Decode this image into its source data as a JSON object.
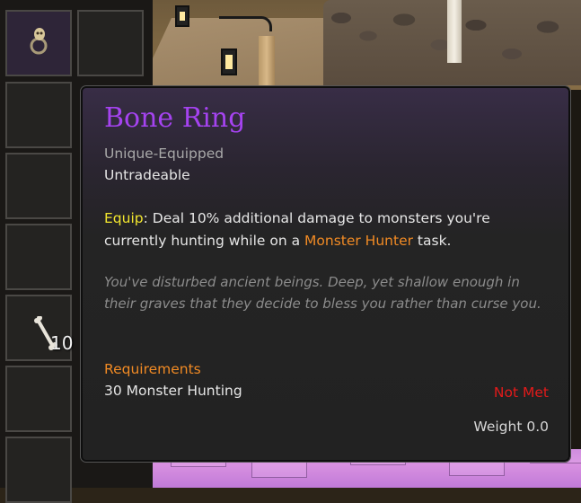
{
  "inventory": {
    "slots": [
      {
        "item": "bone-ring",
        "quantity": ""
      },
      {
        "item": "",
        "quantity": ""
      },
      {
        "item": "bone",
        "quantity": "10"
      }
    ]
  },
  "tooltip": {
    "title": "Bone Ring",
    "tags": [
      "Unique-Equipped",
      "Untradeable"
    ],
    "equip_label": "Equip",
    "equip_text_1": ": Deal 10% additional damage to monsters you're",
    "equip_text_2_pre": "currently hunting while on a ",
    "equip_highlight": "Monster Hunter",
    "equip_text_2_post": " task.",
    "flavor": "You've disturbed ancient beings. Deep, yet shallow enough in their graves that they decide to bless you rather than curse you.",
    "requirements_heading": "Requirements",
    "requirement": "30 Monster Hunting",
    "requirement_status": "Not Met",
    "weight": "Weight 0.0"
  },
  "colors": {
    "title": "#a543f0",
    "equip_label": "#f2e62e",
    "highlight": "#f08a24",
    "not_met": "#e21a1a"
  },
  "icons": [
    "ring-icon",
    "bone-icon",
    "lantern-icon"
  ]
}
